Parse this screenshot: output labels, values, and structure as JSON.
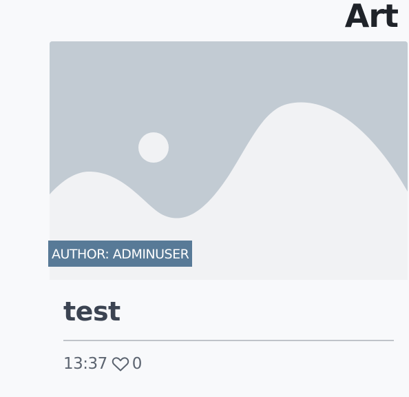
{
  "section": {
    "title": "Art"
  },
  "card": {
    "image_icon": "image-placeholder-icon",
    "author_badge": "AUTHOR: ADMINUSER",
    "title": "test",
    "time": "13:37",
    "like_icon": "heart-outline-icon",
    "likes": "0"
  },
  "colors": {
    "placeholder_bg": "#c2cbd3",
    "placeholder_fg": "#f1f2f4",
    "badge_bg": "#587a97",
    "divider": "#bfc3c9"
  }
}
